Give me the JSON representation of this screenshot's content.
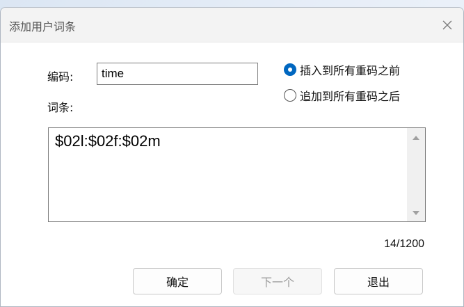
{
  "dialog": {
    "title": "添加用户词条",
    "close_icon": "close-icon"
  },
  "form": {
    "code_label": "编码:",
    "code_value": "time",
    "entry_label": "词条:",
    "entry_text": "$02l:$02f:$02m",
    "char_count": "14/1200"
  },
  "options": {
    "insert_before": {
      "label": "插入到所有重码之前",
      "checked": true
    },
    "append_after": {
      "label": "追加到所有重码之后",
      "checked": false
    }
  },
  "buttons": {
    "ok": "确定",
    "next": "下一个",
    "exit": "退出"
  },
  "colors": {
    "accent": "#0067c0"
  }
}
